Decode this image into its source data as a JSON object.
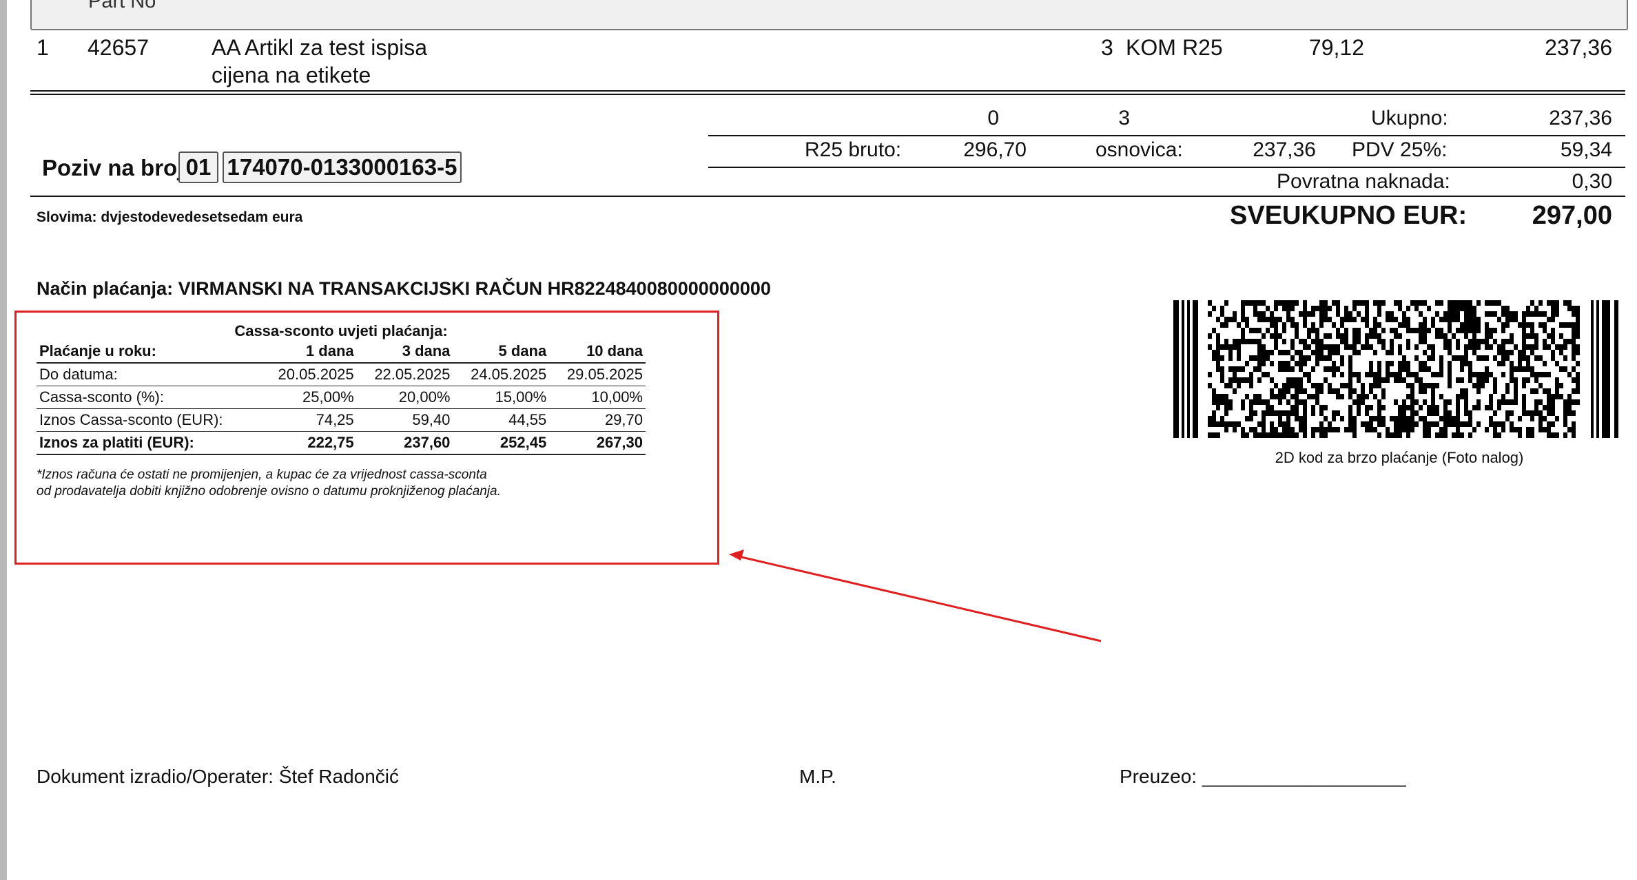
{
  "header": {
    "part_no_label": "Part No"
  },
  "item": {
    "row_no": "1",
    "part_no": "42657",
    "desc_line1": "AA Artikl za test ispisa",
    "desc_line2": "cijena na etikete",
    "qty": "3",
    "unit": "KOM",
    "tax": "R25",
    "price": "79,12",
    "amount": "237,36"
  },
  "summary": {
    "count_zero": "0",
    "count_qty": "3",
    "ukupno_label": "Ukupno:",
    "ukupno_value": "237,36",
    "bruto_label": "R25 bruto:",
    "bruto_value": "296,70",
    "osnovica_label": "osnovica:",
    "osnovica_value": "237,36",
    "pdv_label": "PDV 25%:",
    "pdv_value": "59,34",
    "povratna_label": "Povratna naknada:",
    "povratna_value": "0,30",
    "sveukupno_label": "SVEUKUPNO EUR:",
    "sveukupno_value": "297,00"
  },
  "poziv": {
    "label": "Poziv na broj:",
    "model": "01",
    "number": "174070-0133000163-5"
  },
  "slovima": "Slovima: dvjestodevedesetsedam eura",
  "nacin_placanja": "Način plaćanja: VIRMANSKI NA TRANSAKCIJSKI RAČUN HR8224840080000000000",
  "cassa": {
    "title": "Cassa-sconto uvjeti plaćanja:",
    "header": [
      "Plaćanje u roku:",
      "1 dana",
      "3 dana",
      "5 dana",
      "10 dana"
    ],
    "rows": [
      [
        "Do datuma:",
        "20.05.2025",
        "22.05.2025",
        "24.05.2025",
        "29.05.2025"
      ],
      [
        "Cassa-sconto (%):",
        "25,00%",
        "20,00%",
        "15,00%",
        "10,00%"
      ],
      [
        "Iznos Cassa-sconto (EUR):",
        "74,25",
        "59,40",
        "44,55",
        "29,70"
      ]
    ],
    "total": [
      "Iznos za platiti (EUR):",
      "222,75",
      "237,60",
      "252,45",
      "267,30"
    ],
    "note_line1": "*Iznos računa će ostati ne promijenjen, a kupac će za vrijednost cassa-sconta",
    "note_line2": "od prodavatelja dobiti knjižno odobrenje ovisno o datumu proknjiženog plaćanja."
  },
  "barcode_caption": "2D kod za brzo plaćanje (Foto nalog)",
  "footer": {
    "operater": "Dokument izradio/Operater: Štef Radončić",
    "mp": "M.P.",
    "preuzeo": "Preuzeo: ___________________"
  },
  "colors": {
    "annotation_red": "#e02020"
  }
}
